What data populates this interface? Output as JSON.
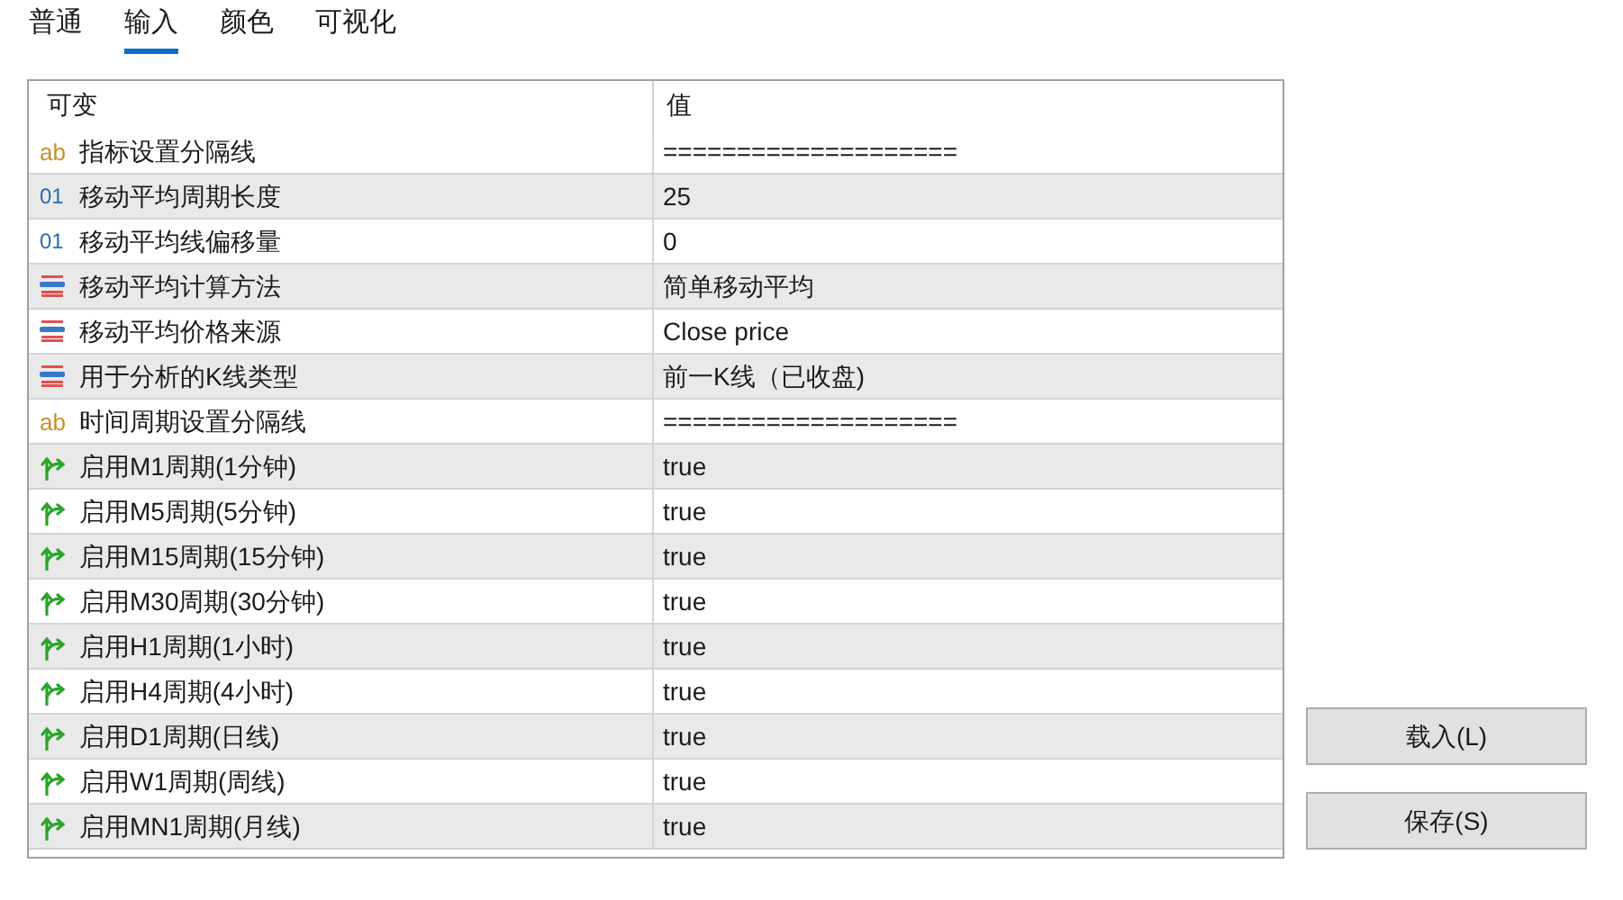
{
  "tabs": [
    {
      "label": "普通",
      "selected": false
    },
    {
      "label": "输入",
      "selected": true
    },
    {
      "label": "颜色",
      "selected": false
    },
    {
      "label": "可视化",
      "selected": false
    }
  ],
  "table": {
    "columns": [
      "可变",
      "值"
    ],
    "rows": [
      {
        "kind": "string",
        "icon": "ab",
        "name": "指标设置分隔线",
        "value": "===================="
      },
      {
        "kind": "int",
        "icon": "01",
        "name": "移动平均周期长度",
        "value": "25"
      },
      {
        "kind": "int",
        "icon": "01",
        "name": "移动平均线偏移量",
        "value": "0"
      },
      {
        "kind": "enum",
        "name": "移动平均计算方法",
        "value": "简单移动平均"
      },
      {
        "kind": "enum",
        "name": "移动平均价格来源",
        "value": "Close price"
      },
      {
        "kind": "enum",
        "name": "用于分析的K线类型",
        "value": "前一K线（已收盘)"
      },
      {
        "kind": "string",
        "icon": "ab",
        "name": "时间周期设置分隔线",
        "value": "===================="
      },
      {
        "kind": "bool",
        "name": "启用M1周期(1分钟)",
        "value": "true"
      },
      {
        "kind": "bool",
        "name": "启用M5周期(5分钟)",
        "value": "true"
      },
      {
        "kind": "bool",
        "name": "启用M15周期(15分钟)",
        "value": "true"
      },
      {
        "kind": "bool",
        "name": "启用M30周期(30分钟)",
        "value": "true"
      },
      {
        "kind": "bool",
        "name": "启用H1周期(1小时)",
        "value": "true"
      },
      {
        "kind": "bool",
        "name": "启用H4周期(4小时)",
        "value": "true"
      },
      {
        "kind": "bool",
        "name": "启用D1周期(日线)",
        "value": "true"
      },
      {
        "kind": "bool",
        "name": "启用W1周期(周线)",
        "value": "true"
      },
      {
        "kind": "bool",
        "name": "启用MN1周期(月线)",
        "value": "true"
      }
    ]
  },
  "buttons": [
    "载入(L)",
    "保存(S)"
  ]
}
